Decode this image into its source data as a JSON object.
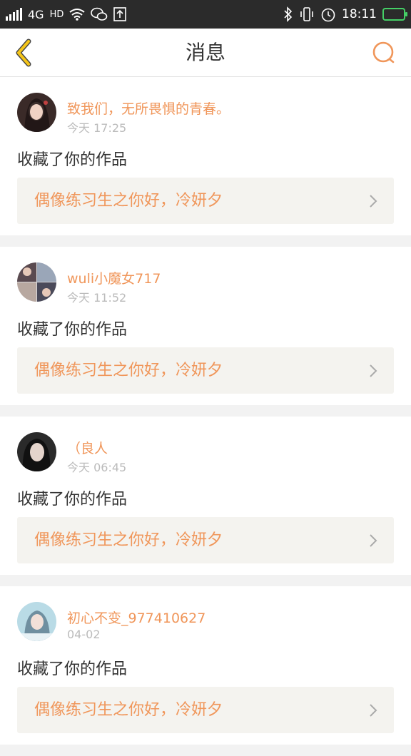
{
  "status_bar": {
    "network": "4G",
    "hd": "HD",
    "time": "18:11",
    "battery_level": 0.7
  },
  "nav": {
    "title": "消息"
  },
  "messages": [
    {
      "username": "致我们，无所畏惧的青春。",
      "time": "今天 17:25",
      "action": "收藏了你的作品",
      "work_title": "偶像练习生之你好，冷妍夕"
    },
    {
      "username": "wuli小魔女717",
      "time": "今天 11:52",
      "action": "收藏了你的作品",
      "work_title": "偶像练习生之你好，冷妍夕"
    },
    {
      "username": "（良人",
      "time": "今天 06:45",
      "action": "收藏了你的作品",
      "work_title": "偶像练习生之你好，冷妍夕"
    },
    {
      "username": "初心不变_977410627",
      "time": "04-02",
      "action": "收藏了你的作品",
      "work_title": "偶像练习生之你好，冷妍夕"
    }
  ],
  "colors": {
    "accent": "#f0965a",
    "back_arrow": "#f5c518"
  }
}
